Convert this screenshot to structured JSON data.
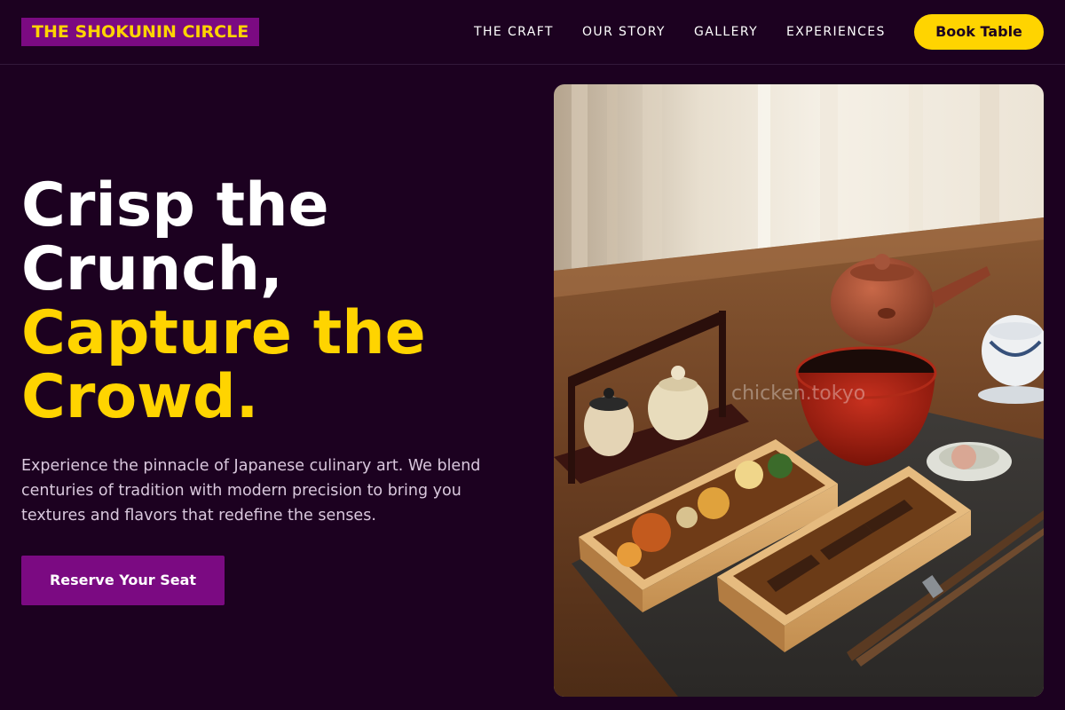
{
  "brand": {
    "name": "THE SHOKUNIN CIRCLE"
  },
  "nav": {
    "items": [
      "THE CRAFT",
      "OUR STORY",
      "GALLERY",
      "EXPERIENCES"
    ],
    "cta_label": "Book Table"
  },
  "hero": {
    "headline_line1": "Crisp the",
    "headline_line2": "Crunch,",
    "headline_line3": "Capture the",
    "headline_line4": "Crowd.",
    "description": "Experience the pinnacle of Japanese culinary art. We blend centuries of tradition with modern precision to bring you textures and flavors that redefine the senses.",
    "button_label": "Reserve Your Seat",
    "image_watermark": "chicken.tokyo"
  },
  "colors": {
    "background": "#1c0120",
    "accent_yellow": "#ffd400",
    "accent_purple": "#7b0a82",
    "text_light": "#d9c8dd"
  }
}
